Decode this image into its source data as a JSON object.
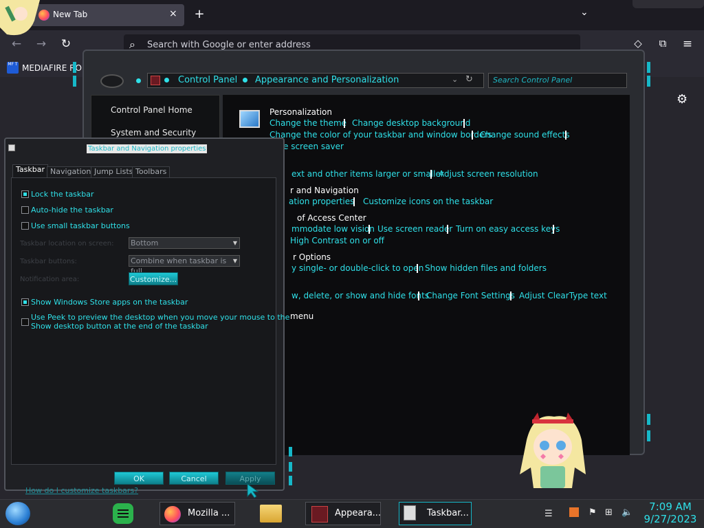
{
  "browser": {
    "tab_title": "New Tab",
    "tab_close_icon": "×",
    "new_tab_icon": "+",
    "list_tabs_icon": "⌄",
    "back_icon": "←",
    "forward_icon": "→",
    "reload_icon": "↻",
    "search_icon": "⌕",
    "url_placeholder": "Search with Google or enter address",
    "pocket_icon": "◇",
    "extensions_icon": "⧉",
    "menu_icon": "≡",
    "bookmark_label": "MEDIAFIRE RO",
    "bookmark_favicon_text": "MF T",
    "settings_icon": "⚙"
  },
  "control_panel": {
    "breadcrumb": [
      "Control Panel",
      "Appearance and Personalization"
    ],
    "search_placeholder": "Search Control Panel",
    "sidebar": [
      "Control Panel Home",
      "System and Security"
    ],
    "sections": [
      {
        "heading": "Personalization",
        "links": [
          "Change the theme",
          "Change desktop background",
          "Change the color of your taskbar and window borders",
          "Change sound effects",
          "e screen saver"
        ]
      },
      {
        "heading": "",
        "links": [
          "ext and other items larger or smaller",
          "Adjust screen resolution"
        ]
      },
      {
        "heading": "r and Navigation",
        "links": [
          "ation properties",
          "Customize icons on the taskbar"
        ]
      },
      {
        "heading": "of Access Center",
        "links": [
          "mmodate low vision",
          "Use screen reader",
          "Turn on easy access keys",
          "High Contrast on or off"
        ]
      },
      {
        "heading": "r Options",
        "links": [
          "y single- or double-click to open",
          "Show hidden files and folders"
        ]
      },
      {
        "heading": "",
        "links": [
          "w, delete, or show and hide fonts",
          "Change Font Settings",
          "Adjust ClearType text"
        ]
      },
      {
        "heading": "menu",
        "links": []
      }
    ]
  },
  "dialog": {
    "title": "Taskbar and Navigation properties",
    "tabs": [
      "Taskbar",
      "Navigation",
      "Jump Lists",
      "Toolbars"
    ],
    "options": [
      {
        "label": "Lock the taskbar",
        "checked": true
      },
      {
        "label": "Auto-hide the taskbar",
        "checked": false
      },
      {
        "label": "Use small taskbar buttons",
        "checked": false
      },
      {
        "label": "Show Windows Store apps on the taskbar",
        "checked": true
      },
      {
        "label": "Use Peek to preview the desktop when you move your mouse to the",
        "label2": "Show desktop button at the end of the taskbar",
        "checked": false
      }
    ],
    "location_label": "Taskbar location on screen:",
    "location_value": "Bottom",
    "buttons_label": "Taskbar buttons:",
    "buttons_value": "Combine when taskbar is full",
    "notification_label": "Notification area:",
    "customize_label": "Customize...",
    "help_link": "How do I customize taskbars?",
    "ok_label": "OK",
    "cancel_label": "Cancel",
    "apply_label": "Apply"
  },
  "taskbar": {
    "items": [
      "Mozilla ...",
      "Appeara...",
      "Taskbar..."
    ],
    "time": "7:09 AM",
    "date": "9/27/2023"
  },
  "colors": {
    "accent": "#2fe0e8",
    "bg": "#1c1b22"
  }
}
